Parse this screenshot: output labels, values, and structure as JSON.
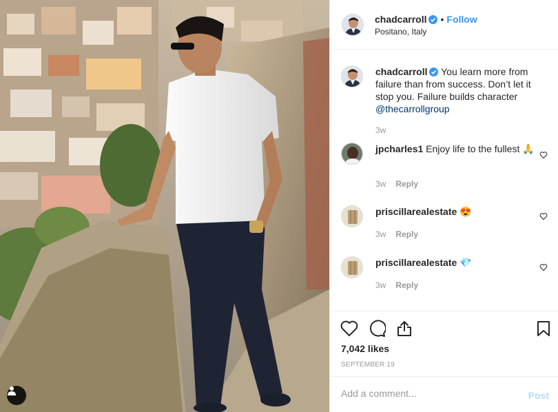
{
  "post": {
    "author": "chadcarroll",
    "location": "Positano, Italy",
    "follow_label": "Follow",
    "dot": "•"
  },
  "caption": {
    "username": "chadcarroll",
    "text": "You learn more from failure than from success. Don’t let it stop you. Failure builds character",
    "mention": "@thecarrollgroup",
    "time": "3w"
  },
  "comments": [
    {
      "username": "jpcharles1",
      "text": "Enjoy life to the fullest",
      "emoji": "🙏",
      "time": "3w",
      "reply_label": "Reply"
    },
    {
      "username": "priscillarealestate",
      "text": "",
      "emoji": "😍",
      "time": "3w",
      "reply_label": "Reply"
    },
    {
      "username": "priscillarealestate",
      "text": "",
      "emoji": "💎",
      "time": "3w",
      "reply_label": "Reply"
    }
  ],
  "stats": {
    "likes": "7,042 likes",
    "date": "SEPTEMBER 19"
  },
  "composer": {
    "placeholder": "Add a comment...",
    "post_label": "Post"
  },
  "colors": {
    "accent": "#3897f0",
    "verified": "#3897f0",
    "muted": "#999999",
    "post_disabled": "#b2dffc"
  },
  "icons": {
    "like": "heart-icon",
    "comment": "comment-icon",
    "share": "share-icon",
    "save": "bookmark-icon",
    "user_tag": "user-tag-icon"
  }
}
